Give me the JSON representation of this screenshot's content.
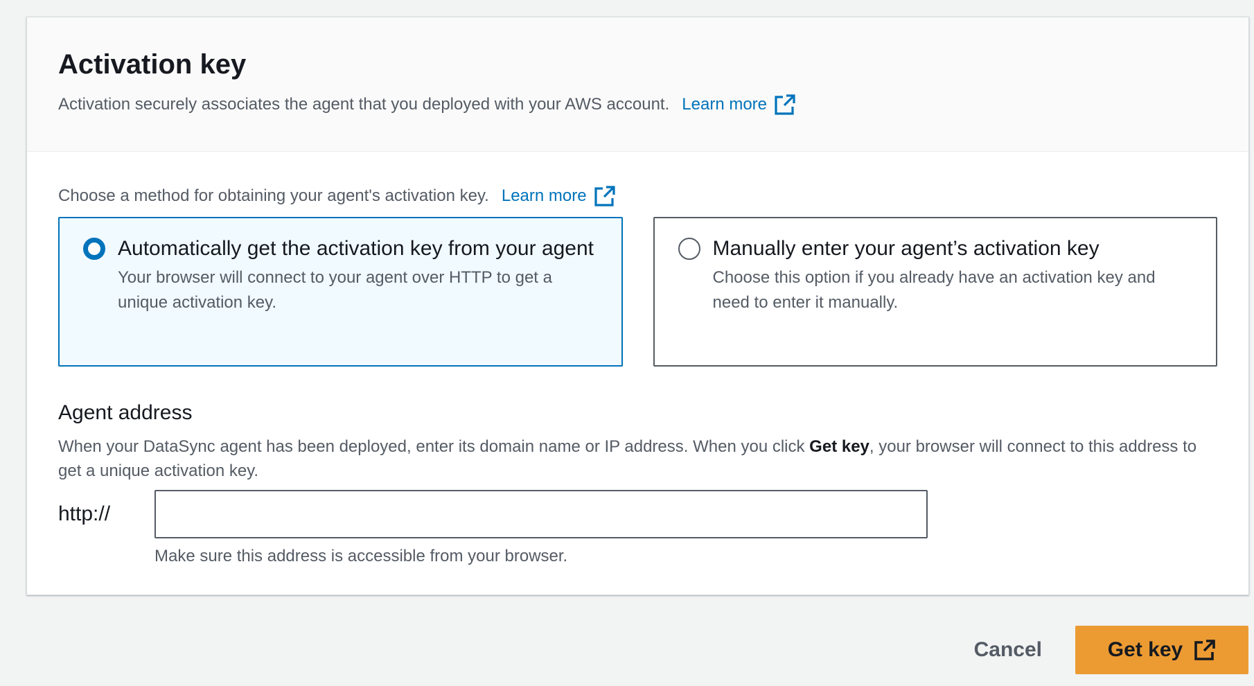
{
  "panel": {
    "title": "Activation key",
    "description": "Activation securely associates the agent that you deployed with your AWS account.",
    "learn_more": "Learn more"
  },
  "method": {
    "description": "Choose a method for obtaining your agent's activation key.",
    "learn_more": "Learn more",
    "options": [
      {
        "label": "Automatically get the activation key from your agent",
        "description": "Your browser will connect to your agent over HTTP to get a unique activation key.",
        "selected": true
      },
      {
        "label": "Manually enter your agent’s activation key",
        "description": "Choose this option if you already have an activation key and need to enter it manually.",
        "selected": false
      }
    ]
  },
  "agent_address": {
    "label": "Agent address",
    "description_before": "When your DataSync agent has been deployed, enter its domain name or IP address. When you click ",
    "description_bold": "Get key",
    "description_after": ", your browser will connect to this address to get a unique activation key.",
    "prefix": "http://",
    "value": "",
    "placeholder": "",
    "constraint": "Make sure this address is accessible from your browser."
  },
  "footer": {
    "cancel_label": "Cancel",
    "primary_label": "Get key"
  },
  "colors": {
    "link": "#0073bb",
    "primary_button": "#ec9b33",
    "selected_tile_bg": "#f1faff"
  },
  "icons": [
    "external-link-icon",
    "radio-icon"
  ]
}
